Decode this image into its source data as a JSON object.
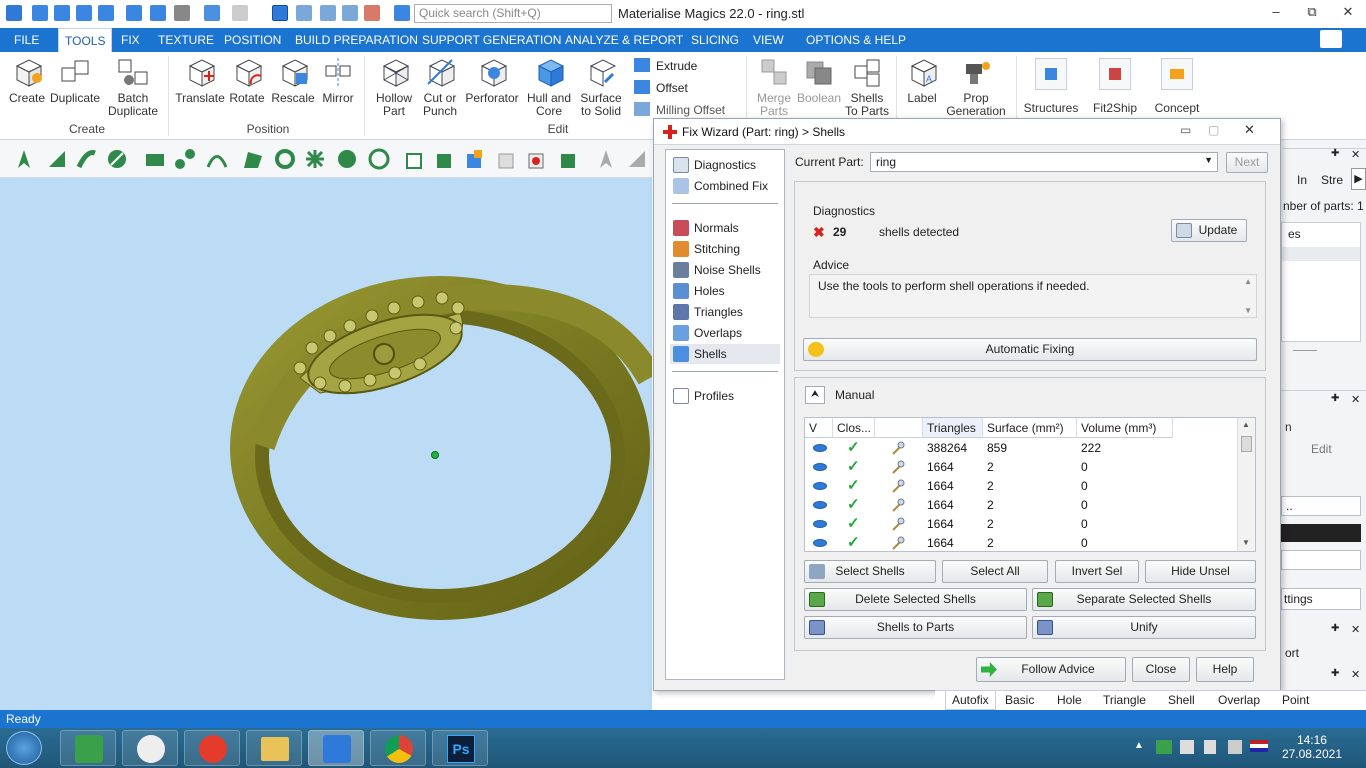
{
  "app": {
    "title": "Materialise Magics 22.0 - ring.stl",
    "search_placeholder": "Quick search (Shift+Q)",
    "window_controls": [
      "–",
      "⧉",
      "✕"
    ]
  },
  "ribbon_tabs": [
    "FILE",
    "TOOLS",
    "FIX",
    "TEXTURE",
    "POSITION",
    "BUILD PREPARATION",
    "SUPPORT GENERATION",
    "ANALYZE & REPORT",
    "SLICING",
    "VIEW",
    "OPTIONS & HELP"
  ],
  "ribbon": {
    "create_group": "Create",
    "position_group": "Position",
    "edit_group": "Edit",
    "create": "Create",
    "duplicate": "Duplicate",
    "batch_duplicate": "Batch Duplicate",
    "translate": "Translate",
    "rotate": "Rotate",
    "rescale": "Rescale",
    "mirror": "Mirror",
    "hollow": "Hollow Part",
    "cut": "Cut or Punch",
    "perforator": "Perforator",
    "hull": "Hull and Core",
    "surface": "Surface to Solid",
    "extrude": "Extrude",
    "offset": "Offset",
    "milling": "Milling Offset",
    "merge": "Merge Parts",
    "boolean": "Boolean",
    "shells_to_parts": "Shells To Parts",
    "label": "Label",
    "prop": "Prop Generation",
    "structures": "Structures",
    "fit2ship": "Fit2Ship",
    "concept": "Concept"
  },
  "dialog": {
    "title": "Fix Wizard (Part: ring) > Shells",
    "nav": {
      "diagnostics": "Diagnostics",
      "combined_fix": "Combined Fix",
      "normals": "Normals",
      "stitching": "Stitching",
      "noise_shells": "Noise Shells",
      "holes": "Holes",
      "triangles": "Triangles",
      "overlaps": "Overlaps",
      "shells": "Shells",
      "profiles": "Profiles"
    },
    "current_part_label": "Current Part:",
    "current_part_value": "ring",
    "next_button": "Next",
    "diagnostics_label": "Diagnostics",
    "shell_count": "29",
    "shells_detected": "shells detected",
    "update_button": "Update",
    "advice_label": "Advice",
    "advice_text": "Use the tools to perform shell operations if needed.",
    "auto_fix_button": "Automatic Fixing",
    "manual_label": "Manual",
    "table": {
      "headers": [
        "V",
        "Clos...",
        "",
        "Triangles",
        "Surface (mm²)",
        "Volume (mm³)"
      ],
      "rows": [
        {
          "triangles": "388264",
          "surface": "859",
          "volume": "222"
        },
        {
          "triangles": "1664",
          "surface": "2",
          "volume": "0"
        },
        {
          "triangles": "1664",
          "surface": "2",
          "volume": "0"
        },
        {
          "triangles": "1664",
          "surface": "2",
          "volume": "0"
        },
        {
          "triangles": "1664",
          "surface": "2",
          "volume": "0"
        },
        {
          "triangles": "1664",
          "surface": "2",
          "volume": "0"
        }
      ]
    },
    "buttons": {
      "select_shells": "Select Shells",
      "select_all": "Select All",
      "invert_sel": "Invert Sel",
      "hide_unsel": "Hide Unsel",
      "delete_selected": "Delete Selected Shells",
      "separate_selected": "Separate Selected Shells",
      "shells_to_parts": "Shells to Parts",
      "unify": "Unify",
      "follow_advice": "Follow Advice",
      "close": "Close",
      "help": "Help"
    }
  },
  "right_panel": {
    "tab1": "In",
    "tab2": "Stre",
    "num_parts": "nber of parts: 1",
    "list_item": "es",
    "edit": "Edit",
    "field": "..",
    "settings": "ttings",
    "ort": "ort"
  },
  "bottom_tabs": [
    "Autofix",
    "Basic",
    "Hole",
    "Triangle",
    "Shell",
    "Overlap",
    "Point"
  ],
  "status_text": "Ready",
  "taskbar": {
    "time": "14:16",
    "date": "27.08.2021"
  },
  "colors": {
    "ribbon_blue": "#1c74d1",
    "viewport_bg": "#bcdcf5",
    "ring_color": "#8c8c2a",
    "check_green": "#21a83a",
    "error_red": "#d8231c"
  }
}
